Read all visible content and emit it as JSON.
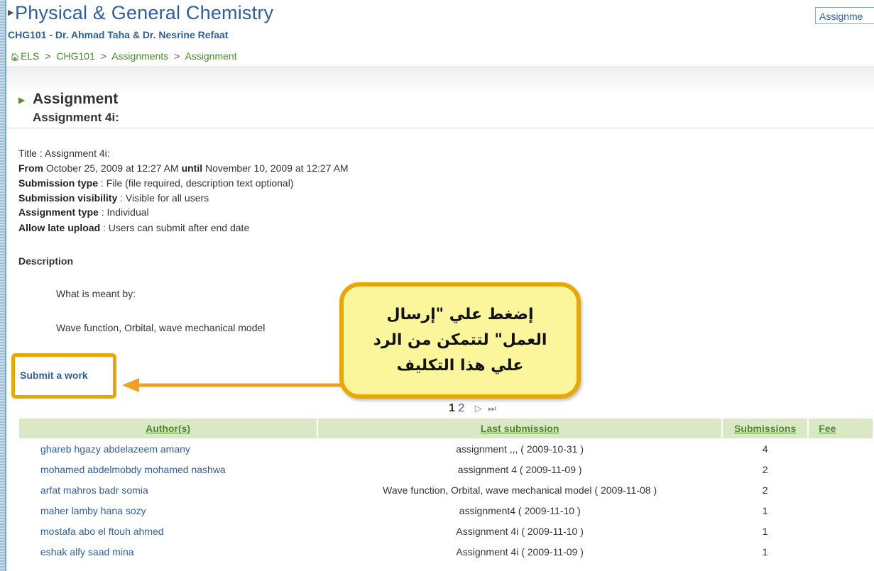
{
  "header": {
    "course_title": "Physical & General Chemistry",
    "course_sub": "CHG101 - Dr. Ahmad Taha & Dr. Nesrine Refaat",
    "top_button": "Assignme",
    "breadcrumb": [
      "ELS",
      "CHG101",
      "Assignments",
      "Assignment"
    ],
    "breadcrumb_sep": ">"
  },
  "section": {
    "title": "Assignment",
    "subtitle": "Assignment 4i:"
  },
  "details": {
    "title_label": "Title",
    "title_value": " : Assignment 4i:",
    "from_label": "From",
    "from_value": " October 25, 2009 at 12:27 AM ",
    "until_label": "until",
    "until_value": " November 10, 2009 at 12:27 AM",
    "subtype_label": "Submission type",
    "subtype_value": " : File (file required, description text optional)",
    "visibility_label": "Submission visibility",
    "visibility_value": " : Visible for all users",
    "atype_label": "Assignment type",
    "atype_value": " : Individual",
    "late_label": "Allow late upload",
    "late_value": " : Users can submit after end date"
  },
  "description": {
    "heading": "Description",
    "line1": "What is meant by:",
    "line2": "Wave function, Orbital, wave mechanical model"
  },
  "submit_link": "Submit a work",
  "callout": {
    "text": "إضغط علي \"إرسال العمل\" لتتمكن من الرد علي هذا التكليف"
  },
  "pager": {
    "current": "1",
    "next_page": "2",
    "next_icon": "▷",
    "last_icon": "⏭"
  },
  "table": {
    "headers": [
      "Author(s)",
      "Last submission",
      "Submissions",
      "Fee"
    ],
    "rows": [
      [
        "ghareb hgazy abdelazeem amany",
        "assignment ,,, ( 2009-10-31 )",
        "4"
      ],
      [
        "mohamed abdelmobdy mohamed nashwa",
        "assignment 4 ( 2009-11-09 )",
        "2"
      ],
      [
        "arfat mahros badr somia",
        "Wave function, Orbital, wave mechanical model ( 2009-11-08 )",
        "2"
      ],
      [
        "maher lamby hana sozy",
        "assignment4 ( 2009-11-10 )",
        "1"
      ],
      [
        "mostafa abo el ftouh ahmed",
        "Assignment 4i ( 2009-11-10 )",
        "1"
      ],
      [
        "eshak alfy saad mina",
        "Assignment 4i ( 2009-11-09 )",
        "1"
      ]
    ]
  },
  "colors": {
    "link_blue": "#2f5e9c",
    "green": "#4a8a2a",
    "callout_bg": "#fbf59c",
    "highlight_orange": "#e8a800",
    "arrow_orange": "#f0a020"
  }
}
